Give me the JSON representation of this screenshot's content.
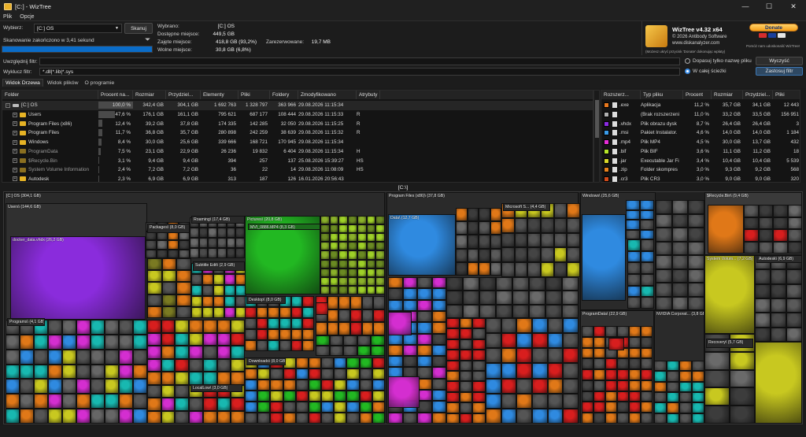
{
  "window": {
    "title": "[C:] - WizTree",
    "min": "—",
    "max": "☐",
    "close": "✕"
  },
  "menu": [
    "Plik",
    "Opcje"
  ],
  "scan": {
    "select_label": "Wybierz:",
    "drive_value": "[C:] OS",
    "scan_button": "Skanuj",
    "status": "Skanowanie zakończono w 3,41 sekund",
    "progress": 1.0
  },
  "stats": {
    "selected_label": "Wybrano:",
    "selected_value": "[C:]  OS",
    "available_label": "Dostępne miejsce:",
    "available_value": "449,5 GB",
    "used_label": "Zajęte miejsce:",
    "used_value": "418,8 GB  (93,2%)",
    "free_label": "Wolne miejsce:",
    "free_value": "30,8 GB  (6,8%)",
    "reserved_label": "Zarezerwowane:",
    "reserved_value": "19,7 MB"
  },
  "about": {
    "name": "WizTree v4.32 x64",
    "copyright": "© 2026 Antibody Software",
    "site": "www.diskanalyzer.com",
    "note": "(Możesz ukryć przycisk 'Donate' dokonując wpłaty)",
    "donate": "Donate",
    "donate_note": "Pomóż nam udoskonalić WizTree!"
  },
  "filters": {
    "include_label": "Uwzględnij filtr:",
    "include_value": "",
    "exclude_label": "Wyklucz filtr:",
    "exclude_value": "*.dll|*.lib|*.sys",
    "opt_name": "Dopasuj tylko nazwę pliku",
    "opt_path": "W całej ścieżki",
    "clear_button": "Wyczyść",
    "apply_button": "Zastosuj filtr"
  },
  "tabs": [
    "Widok Drzewa",
    "Widok plików",
    "O programie"
  ],
  "tree": {
    "headers": [
      "Folder",
      "Procent na...",
      "Rozmiar",
      "Przydziel...",
      "Elementy",
      "Pliki",
      "Foldery",
      "Zmodyfikowano",
      "Atrybuty"
    ],
    "rows": [
      {
        "name": "[C:] OS",
        "pct": "100,0 %",
        "p": 1.0,
        "size": "342,4 GB",
        "alloc": "304,1 GB",
        "items": "1 692 763",
        "files": "1 328 797",
        "folders": "363 966",
        "mod": "29.08.2026 11:15:34",
        "attr": "",
        "level": 0,
        "icon": "drive"
      },
      {
        "name": "Users",
        "pct": "47,6 %",
        "p": 0.476,
        "size": "176,1 GB",
        "alloc": "161,1 GB",
        "items": "795 621",
        "files": "687 177",
        "folders": "108 444",
        "mod": "29.08.2026 11:15:33",
        "attr": "R",
        "level": 1,
        "icon": "folder"
      },
      {
        "name": "Program Files (x86)",
        "pct": "12,4 %",
        "p": 0.124,
        "size": "39,2 GB",
        "alloc": "37,8 GB",
        "items": "174 335",
        "files": "142 285",
        "folders": "32 050",
        "mod": "29.08.2026 11:15:25",
        "attr": "R",
        "level": 1,
        "icon": "folder"
      },
      {
        "name": "Program Files",
        "pct": "11,7 %",
        "p": 0.117,
        "size": "36,8 GB",
        "alloc": "35,7 GB",
        "items": "280 898",
        "files": "242 259",
        "folders": "38 639",
        "mod": "29.08.2026 11:15:32",
        "attr": "R",
        "level": 1,
        "icon": "folder"
      },
      {
        "name": "Windows",
        "pct": "8,4 %",
        "p": 0.084,
        "size": "30,0 GB",
        "alloc": "25,6 GB",
        "items": "339 666",
        "files": "168 721",
        "folders": "170 945",
        "mod": "29.08.2026 11:15:34",
        "attr": "",
        "level": 1,
        "icon": "folder"
      },
      {
        "name": "ProgramData",
        "pct": "7,5 %",
        "p": 0.075,
        "size": "23,1 GB",
        "alloc": "22,9 GB",
        "items": "26 236",
        "files": "19 832",
        "folders": "6 404",
        "mod": "29.08.2026 11:15:34",
        "attr": "H",
        "level": 1,
        "icon": "folder-dim"
      },
      {
        "name": "$Recycle.Bin",
        "pct": "3,1 %",
        "p": 0.031,
        "size": "9,4 GB",
        "alloc": "9,4 GB",
        "items": "394",
        "files": "257",
        "folders": "137",
        "mod": "25.08.2026 15:39:27",
        "attr": "HS",
        "level": 1,
        "icon": "recycle"
      },
      {
        "name": "System Volume Information",
        "pct": "2,4 %",
        "p": 0.024,
        "size": "7,2 GB",
        "alloc": "7,2 GB",
        "items": "36",
        "files": "22",
        "folders": "14",
        "mod": "29.08.2026 11:08:09",
        "attr": "HS",
        "level": 1,
        "icon": "folder-dim"
      },
      {
        "name": "Autodesk",
        "pct": "2,3 %",
        "p": 0.023,
        "size": "6,9 GB",
        "alloc": "6,9 GB",
        "items": "313",
        "files": "187",
        "folders": "126",
        "mod": "16.01.2026 20:56:43",
        "attr": "",
        "level": 1,
        "icon": "folder"
      }
    ]
  },
  "ext": {
    "headers": [
      "Rozszerz...",
      "Typ pliku",
      "Procent",
      "Rozmiar",
      "Przydziel...",
      "Pliki"
    ],
    "rows": [
      {
        "color": "#e8781e",
        "ext": ".exe",
        "type": "Aplikacja",
        "pct": "11,2 %",
        "size": "35,7 GB",
        "alloc": "34,1 GB",
        "files": "12 443"
      },
      {
        "color": "#b0b0b0",
        "ext": "",
        "type": "(Brak rozszerzeni",
        "pct": "11,0 %",
        "size": "33,2 GB",
        "alloc": "33,5 GB",
        "files": "156 951"
      },
      {
        "color": "#8b2be2",
        "ext": ".vhdx",
        "type": "Plik obrazu dysk",
        "pct": "8,7 %",
        "size": "26,4 GB",
        "alloc": "26,4 GB",
        "files": "3"
      },
      {
        "color": "#3a9be8",
        "ext": ".msi",
        "type": "Pakiet Instalator.",
        "pct": "4,6 %",
        "size": "14,0 GB",
        "alloc": "14,0 GB",
        "files": "1 184"
      },
      {
        "color": "#e62ed6",
        "ext": ".mp4",
        "type": "Plik MP4",
        "pct": "4,5 %",
        "size": "30,0 GB",
        "alloc": "13,7 GB",
        "files": "432"
      },
      {
        "color": "#b6e52a",
        "ext": ".bif",
        "type": "Plik BIF",
        "pct": "3,6 %",
        "size": "11,1 GB",
        "alloc": "11,2 GB",
        "files": "18"
      },
      {
        "color": "#d8d82a",
        "ext": ".jar",
        "type": "Executable Jar Fi",
        "pct": "3,4 %",
        "size": "10,4 GB",
        "alloc": "10,4 GB",
        "files": "5 539"
      },
      {
        "color": "#e8821e",
        "ext": ".zip",
        "type": "Folder skompres",
        "pct": "3,0 %",
        "size": "9,3 GB",
        "alloc": "9,2 GB",
        "files": "568"
      },
      {
        "color": "#d04a1a",
        "ext": ".cr3",
        "type": "Plik CR3",
        "pct": "3,0 %",
        "size": "9,0 GB",
        "alloc": "9,0 GB",
        "files": "320"
      }
    ]
  },
  "path": "[C:\\]",
  "treemap": {
    "colors": {
      "vhdx": "#8a2cdc",
      "mp4": "#d42ed0",
      "msi": "#2f8ae0",
      "exe": "#e07818",
      "noext": "#606060",
      "bif": "#9ed028",
      "jar": "#c8c820",
      "green": "#22b822",
      "red": "#d81e1e",
      "teal": "#18b8b0"
    },
    "labels": [
      "[C:] OS (304,1 GB)",
      "Users\\ (144,6 GB)",
      "(144,0 GB)",
      "AppData\\ (91,9 GB)",
      "Local\\ (70,7 GB)",
      "Docker\\ (26,3 GB)",
      "wsl\\ (26,3 GB)",
      "disk\\ (26,2 GB)",
      "docker_data.vhdx (26,2 GB)",
      "Packages\\ (8,0 GB)",
      "PythonS... (2,7 GB)",
      "LocalC... (2,7 GB)",
      "local-... (2,7 GB)",
      "Roaming\\ (17,4 GB)",
      "Maxon\\ (4,4 GB)",
      "Cinebench202... (4,3 GB)",
      "Redshift\\ (4,3 GB)",
      "Cache\\ (4,3 GB)",
      "Textures\\ (4,3 GB)",
      "Spotify... (2,6 GB)",
      "Local\\ (2,6 GB)",
      "Data\\ (2,6 GB)",
      "Subtitle Edit\\ (2,9 GB)",
      "SpeechToText\\ (2,9 GB)",
      "Cpp\\ (2,9 GB)",
      "Models\\ (2,9 GB)",
      "Pictures\\ (20,8 GB)",
      "2026_08_01\\ (11,4 GB)",
      "MVI_0886.MP4 (8,3 GB)",
      "202... (3,6 GB)",
      "Desktop\\ (8,0 GB)",
      "CS6... (1,7 GB)",
      "Documents\\ (4,7 GB)",
      "Videos\\ (4,0 GB)",
      "Downloads\\ (8,0 GB)",
      "Programs\\ (4,1 GB)",
      "Micro... (2,4 GB)",
      "Roblox\\ (3,4 GB)",
      "CapCut\\ (2,9 GB)",
      "BraveSoft... (2,9 GB)",
      "Brave-Br... (2,9 GB)",
      "User Data\\ (2,9 GB)",
      "Microsoft\\ (2,4 GB)",
      "Local\\ (3,7 GB)",
      "Instan... (2,5 GB)",
      "LocalLow\\ (3,0 GB)",
      "Colossal Order\\ (2,7 GB)",
      "Cities Skyline... (2,7 GB)",
      "Saves\\ (2,3 GB)",
      "25554f49... (2,3 GB)",
      "Program Files (x86)\\ (37,8 GB)",
      "Steam\\ (22,3 GB)",
      "steamapps\\ (21,4 GB)",
      "common\\ (21,4 GB)",
      "The Witcher Enhanced Edition\\ (15,6 GB)",
      "Data\\ (12,7 GB)",
      "Microsoft S... (4,4 GB)",
      "Program Files\\ (35,7 GB)",
      "WindowsApps\\ (6,9 GB)",
      "Docker\\ (3,3 GB)",
      "Doc... (3,3 GB)",
      "Microsoft ... (3,2 GB)",
      "2022\\ (3,2 GB)",
      "Commu... (3,2 GB)",
      "JetBrains\\ (4,0 GB)",
      "dotnet\\ (3,3 GB)",
      "packs\\ (3,0 GB)",
      "... (57,5 MB)",
      "Windows\\ (25,6 GB)",
      "Installer\\ (10,9 GB)",
      "System32\\ (4,9 GB)",
      "WinSxS\\ (4,0 GB)",
      "ProgramData\\ (22,9 GB)",
      "Microsoft\\ (12,7 GB)",
      "VisualStudio\\ (11,2 GB)",
      "Packages\\ (11,2 GB)",
      "... (782,5 MB)",
      "NVIDIA Corporat... (3,8 GB)",
      "NVIDI... (2,6 GB)",
      "Upd... (2,6 GB)",
      "Package Cache\\ (2,4 GB)",
      "$Recycle.Bin\\ (9,4 GB)",
      "S-1-5-21-443142556-3170071070-1981... (9,4 GB)",
      "System Volum... (7,2 GB)",
      "{4ea4a94-da07-11f5-9d4d-1}",
      "Autodesk\\ (6,9 GB)",
      "WI\\ (6,9 GB)",
      "Recovery\\ (5,7 GB)",
      "Custo... (5,6 GB)",
      "ucmt.ppkg (5,6 GB)"
    ]
  }
}
